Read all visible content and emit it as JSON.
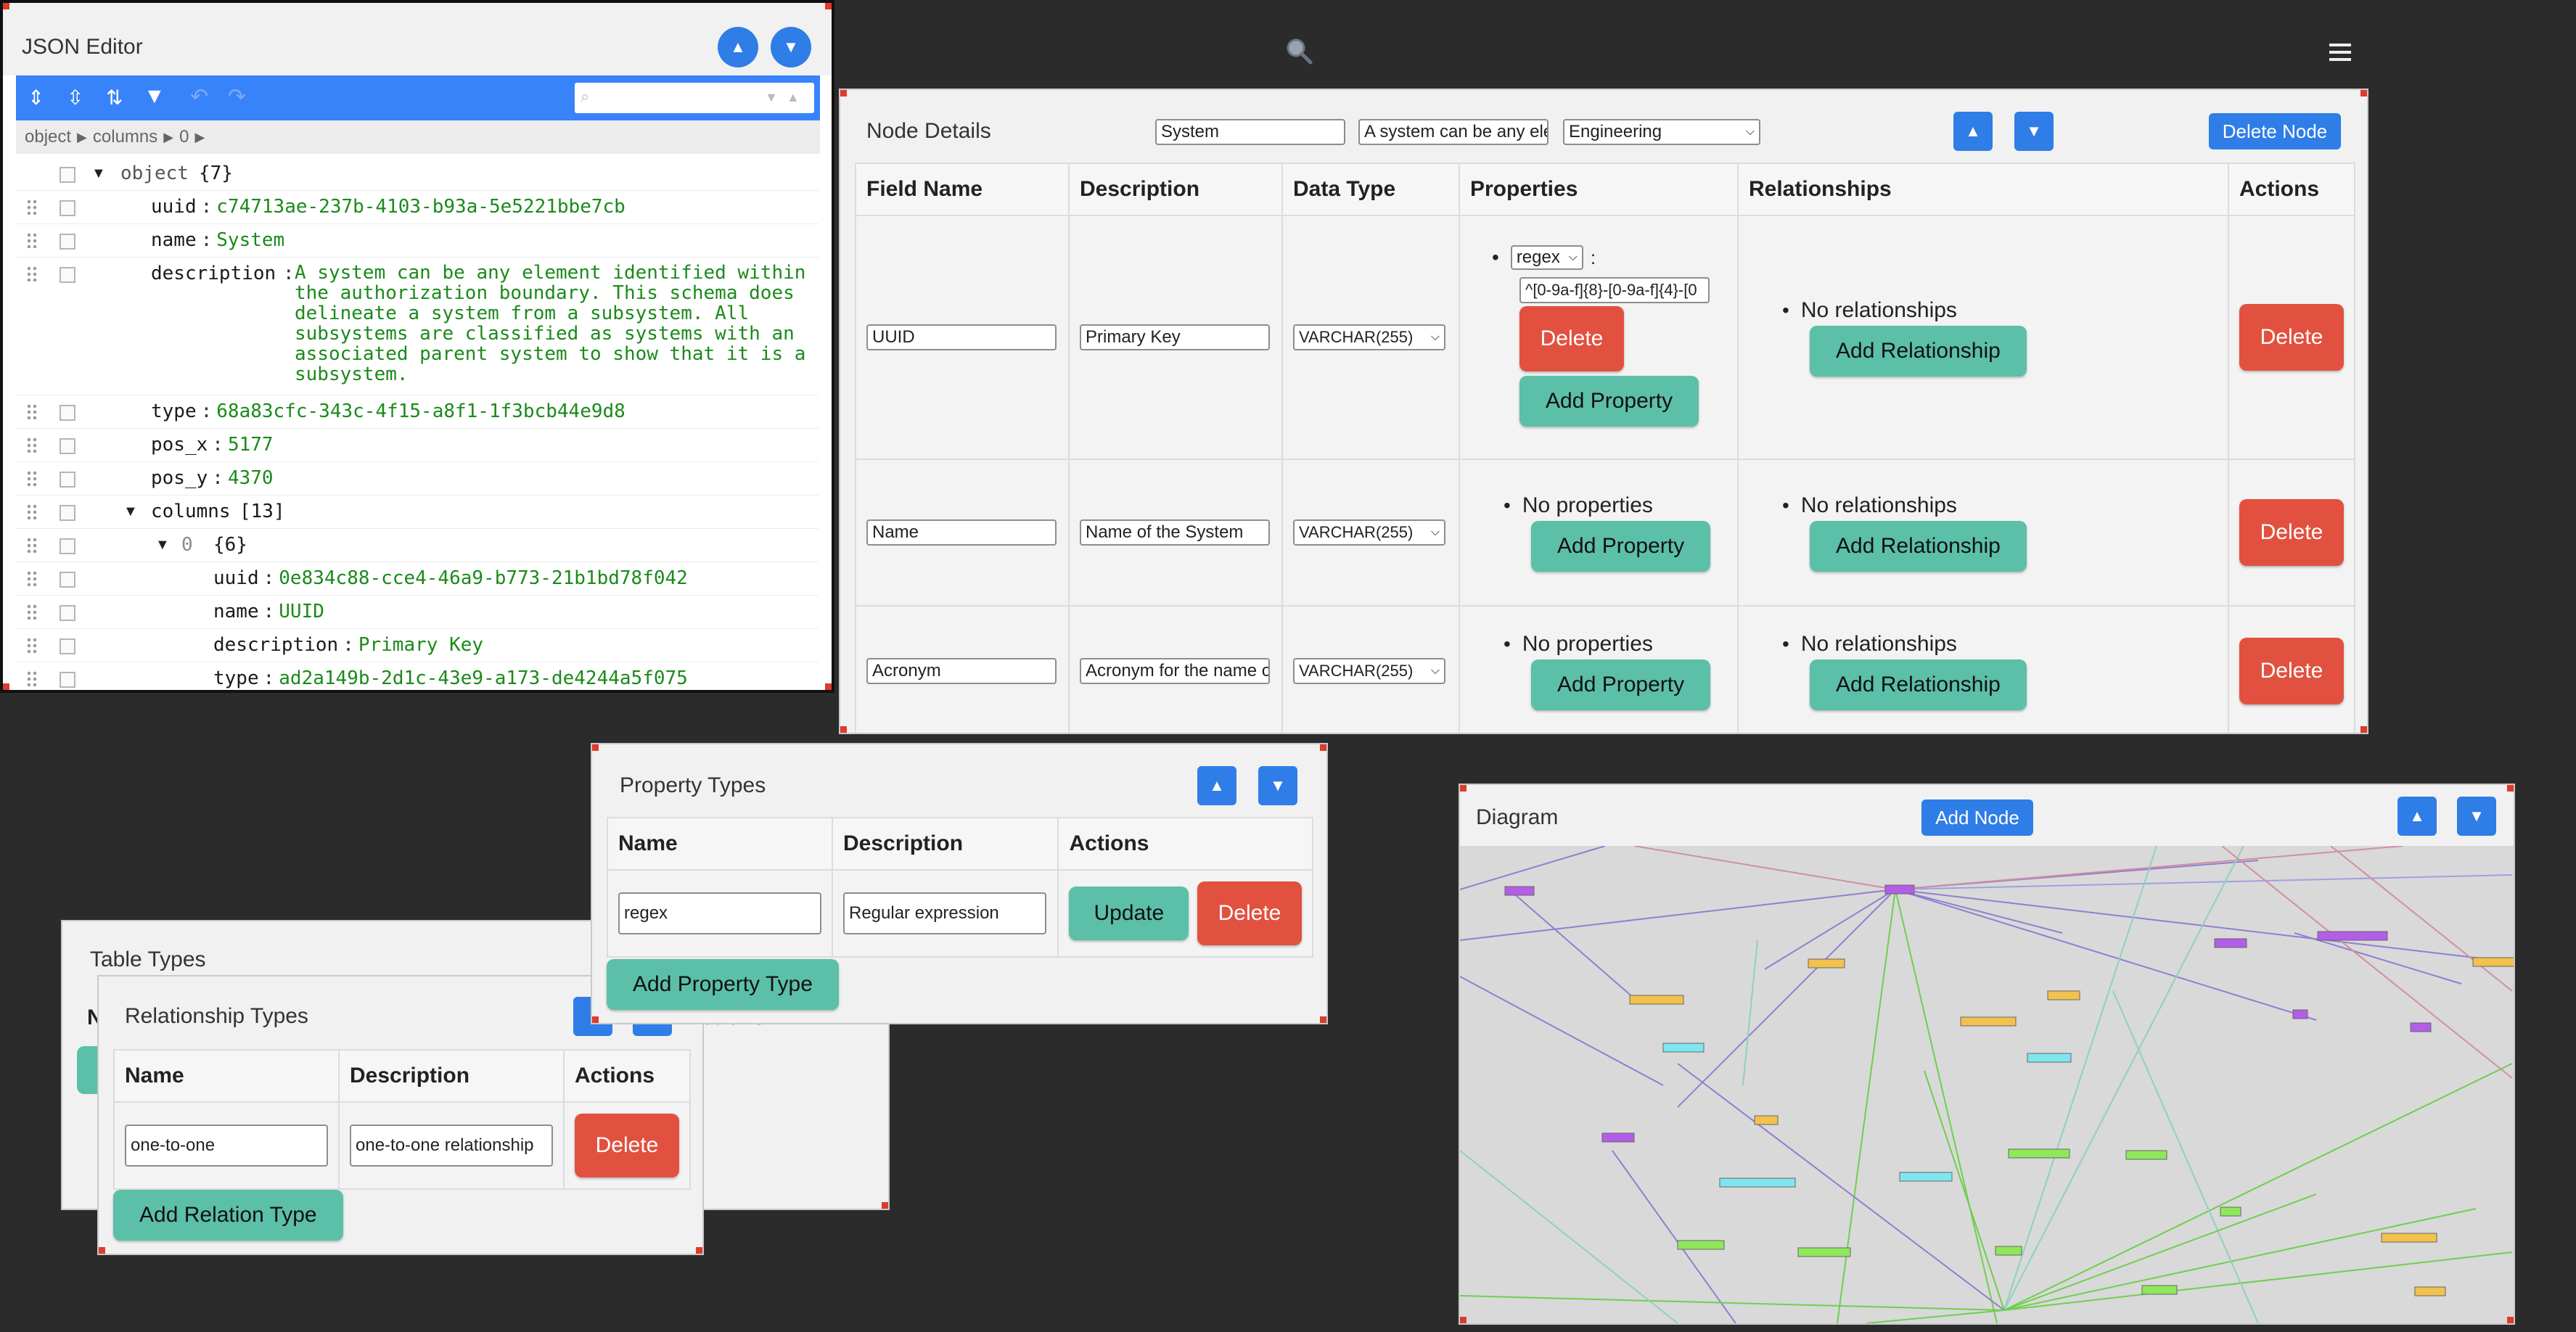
{
  "top": {
    "search_icon": "magnifier-icon",
    "menu_icon": "hamburger-icon"
  },
  "json_editor": {
    "title": "JSON Editor",
    "up": "▲",
    "down": "▼",
    "breadcrumb": [
      "object",
      "columns",
      "0"
    ],
    "root_label": "object",
    "root_count": "{7}",
    "fields": {
      "uuid_key": "uuid",
      "uuid_val": "c74713ae-237b-4103-b93a-5e5221bbe7cb",
      "name_key": "name",
      "name_val": "System",
      "desc_key": "description",
      "desc_lines": [
        "A system can be any element identified within",
        "the authorization boundary. This schema does",
        "delineate a system from a subsystem. All",
        "subsystems are classified as systems with an",
        "associated parent system to show that it is a",
        "subsystem."
      ],
      "type_key": "type",
      "type_val": "68a83cfc-343c-4f15-a8f1-1f3bcb44e9d8",
      "posx_key": "pos_x",
      "posx_val": "5177",
      "posy_key": "pos_y",
      "posy_val": "4370",
      "columns_key": "columns",
      "columns_count": "[13]",
      "item_index": "0",
      "item_count": "{6}",
      "c_uuid_key": "uuid",
      "c_uuid_val": "0e834c88-cce4-46a9-b773-21b1bd78f042",
      "c_name_key": "name",
      "c_name_val": "UUID",
      "c_desc_key": "description",
      "c_desc_val": "Primary Key",
      "c_type_key": "type",
      "c_type_val": "ad2a149b-2d1c-43e9-a173-de4244a5f075"
    }
  },
  "node_details": {
    "title": "Node Details",
    "name_value": "System",
    "desc_value": "A system can be any ele",
    "category_value": "Engineering",
    "delete_node": "Delete Node",
    "up": "▲",
    "down": "▼",
    "headers": [
      "Field Name",
      "Description",
      "Data Type",
      "Properties",
      "Relationships",
      "Actions"
    ],
    "rows": [
      {
        "field": "UUID",
        "desc": "Primary Key",
        "type": "VARCHAR(255)",
        "prop_select": "regex",
        "prop_value": "^[0-9a-f]{8}-[0-9a-f]{4}-[0",
        "prop_delete": "Delete",
        "add_property": "Add Property",
        "relationships": "No relationships",
        "add_relationship": "Add Relationship",
        "delete": "Delete"
      },
      {
        "field": "Name",
        "desc": "Name of the System",
        "type": "VARCHAR(255)",
        "properties": "No properties",
        "add_property": "Add Property",
        "relationships": "No relationships",
        "add_relationship": "Add Relationship",
        "delete": "Delete"
      },
      {
        "field": "Acronym",
        "desc": "Acronym for the name o",
        "type": "VARCHAR(255)",
        "properties": "No properties",
        "add_property": "Add Property",
        "relationships": "No relationships",
        "add_relationship": "Add Relationship",
        "delete": "Delete"
      }
    ]
  },
  "property_types": {
    "title": "Property Types",
    "up": "▲",
    "down": "▼",
    "headers": [
      "Name",
      "Description",
      "Actions"
    ],
    "rows": [
      {
        "name": "regex",
        "desc": "Regular expression",
        "update": "Update",
        "delete": "Delete"
      }
    ],
    "add": "Add Property Type"
  },
  "table_types": {
    "title": "Table Types",
    "partial_header": "ctions",
    "partial_left": "N"
  },
  "relationship_types": {
    "title": "Relationship Types",
    "headers": [
      "Name",
      "Description",
      "Actions"
    ],
    "rows": [
      {
        "name": "one-to-one",
        "desc": "one-to-one relationship",
        "delete": "Delete"
      }
    ],
    "add": "Add Relation Type"
  },
  "diagram": {
    "title": "Diagram",
    "add_node": "Add Node",
    "up": "▲",
    "down": "▼",
    "colors": {
      "purple": "#b35ee8",
      "yellow": "#f2c14e",
      "cyan": "#7fe6f0",
      "green": "#8ee85a"
    }
  },
  "colors": {
    "accent": "#2f7de6",
    "teal": "#5cbfa8",
    "danger": "#e2513f"
  }
}
